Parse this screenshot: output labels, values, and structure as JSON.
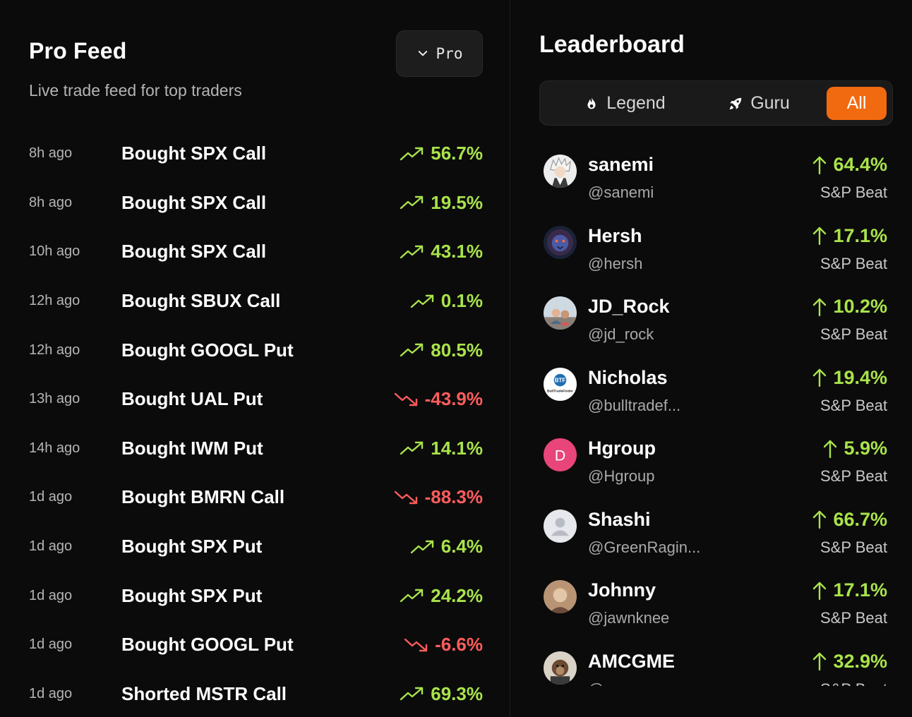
{
  "feed": {
    "title": "Pro Feed",
    "subtitle": "Live trade feed for top traders",
    "filter": {
      "selected": "Pro",
      "icon": "chevron-down-icon"
    },
    "items": [
      {
        "time": "8h ago",
        "trade": "Bought SPX Call",
        "change": "56.7%",
        "direction": "up"
      },
      {
        "time": "8h ago",
        "trade": "Bought SPX Call",
        "change": "19.5%",
        "direction": "up"
      },
      {
        "time": "10h ago",
        "trade": "Bought SPX Call",
        "change": "43.1%",
        "direction": "up"
      },
      {
        "time": "12h ago",
        "trade": "Bought SBUX Call",
        "change": "0.1%",
        "direction": "up"
      },
      {
        "time": "12h ago",
        "trade": "Bought GOOGL Put",
        "change": "80.5%",
        "direction": "up"
      },
      {
        "time": "13h ago",
        "trade": "Bought UAL Put",
        "change": "-43.9%",
        "direction": "down"
      },
      {
        "time": "14h ago",
        "trade": "Bought IWM Put",
        "change": "14.1%",
        "direction": "up"
      },
      {
        "time": "1d ago",
        "trade": "Bought BMRN Call",
        "change": "-88.3%",
        "direction": "down"
      },
      {
        "time": "1d ago",
        "trade": "Bought SPX Put",
        "change": "6.4%",
        "direction": "up"
      },
      {
        "time": "1d ago",
        "trade": "Bought SPX Put",
        "change": "24.2%",
        "direction": "up"
      },
      {
        "time": "1d ago",
        "trade": "Bought GOOGL Put",
        "change": "-6.6%",
        "direction": "down"
      },
      {
        "time": "1d ago",
        "trade": "Shorted MSTR Call",
        "change": "69.3%",
        "direction": "up"
      }
    ]
  },
  "leaderboard": {
    "title": "Leaderboard",
    "tabs": [
      {
        "label": "Legend",
        "icon": "flame-icon"
      },
      {
        "label": "Guru",
        "icon": "rocket-icon"
      },
      {
        "label": "All",
        "icon": "",
        "active": true
      }
    ],
    "entries": [
      {
        "name": "sanemi",
        "handle": "@sanemi",
        "gain": "64.4%",
        "label": "S&P Beat",
        "avatar": "anime-character-avatar"
      },
      {
        "name": "Hersh",
        "handle": "@hersh",
        "gain": "17.1%",
        "label": "S&P Beat",
        "avatar": "lion-avatar"
      },
      {
        "name": "JD_Rock",
        "handle": "@jd_rock",
        "gain": "10.2%",
        "label": "S&P Beat",
        "avatar": "people-photo-avatar"
      },
      {
        "name": "Nicholas",
        "handle": "@bulltradef...",
        "gain": "19.4%",
        "label": "S&P Beat",
        "avatar": "bulltradefinder-logo-avatar",
        "logo_text": "BulltradeFinder"
      },
      {
        "name": "Hgroup",
        "handle": "@Hgroup",
        "gain": "5.9%",
        "label": "S&P Beat",
        "avatar": "letter-avatar",
        "initial": "D"
      },
      {
        "name": "Shashi",
        "handle": "@GreenRagin...",
        "gain": "66.7%",
        "label": "S&P Beat",
        "avatar": "default-user-avatar"
      },
      {
        "name": "Johnny",
        "handle": "@jawnknee",
        "gain": "17.1%",
        "label": "S&P Beat",
        "avatar": "portrait-photo-avatar"
      },
      {
        "name": "AMCGME",
        "handle": "@amcgme",
        "gain": "32.9%",
        "label": "S&P Beat",
        "avatar": "monkey-photo-avatar"
      }
    ]
  },
  "colors": {
    "background": "#0b0b0b",
    "positive": "#a9e34b",
    "negative": "#ff5c5c",
    "accent": "#f26a10",
    "letter_avatar": "#e8457a"
  }
}
